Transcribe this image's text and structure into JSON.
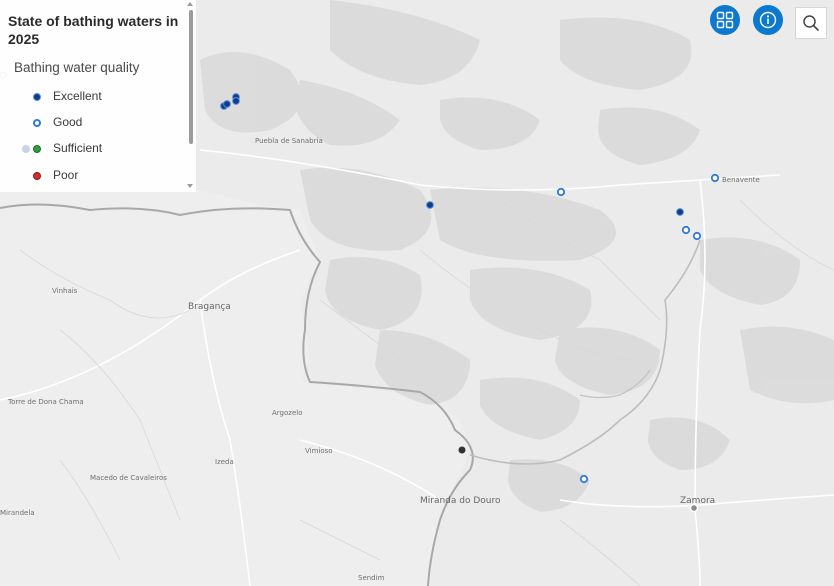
{
  "legend": {
    "title": "State of bathing waters in 2025",
    "subtitle": "Bathing water quality",
    "items": [
      {
        "label": "Excellent",
        "color": "#0d3d8c",
        "style": "filled"
      },
      {
        "label": "Good",
        "color": "#2e7bd6",
        "style": "ring"
      },
      {
        "label": "Sufficient",
        "color": "#2e9e3f",
        "style": "filled"
      },
      {
        "label": "Poor",
        "color": "#d22c2c",
        "style": "filled"
      }
    ]
  },
  "toolbar": {
    "basemap_icon": "grid-icon",
    "info_icon": "info-icon",
    "search_icon": "search-icon",
    "accent": "#0b79d0"
  },
  "places": [
    "Puebla de Sanabria",
    "Benavente",
    "Vinhais",
    "Bragança",
    "Torre de Dona Chama",
    "Argozelo",
    "Vimioso",
    "Izeda",
    "Macedo de Cavaleiros",
    "Mirandela",
    "Miranda do Douro",
    "Zamora",
    "Sendim"
  ]
}
